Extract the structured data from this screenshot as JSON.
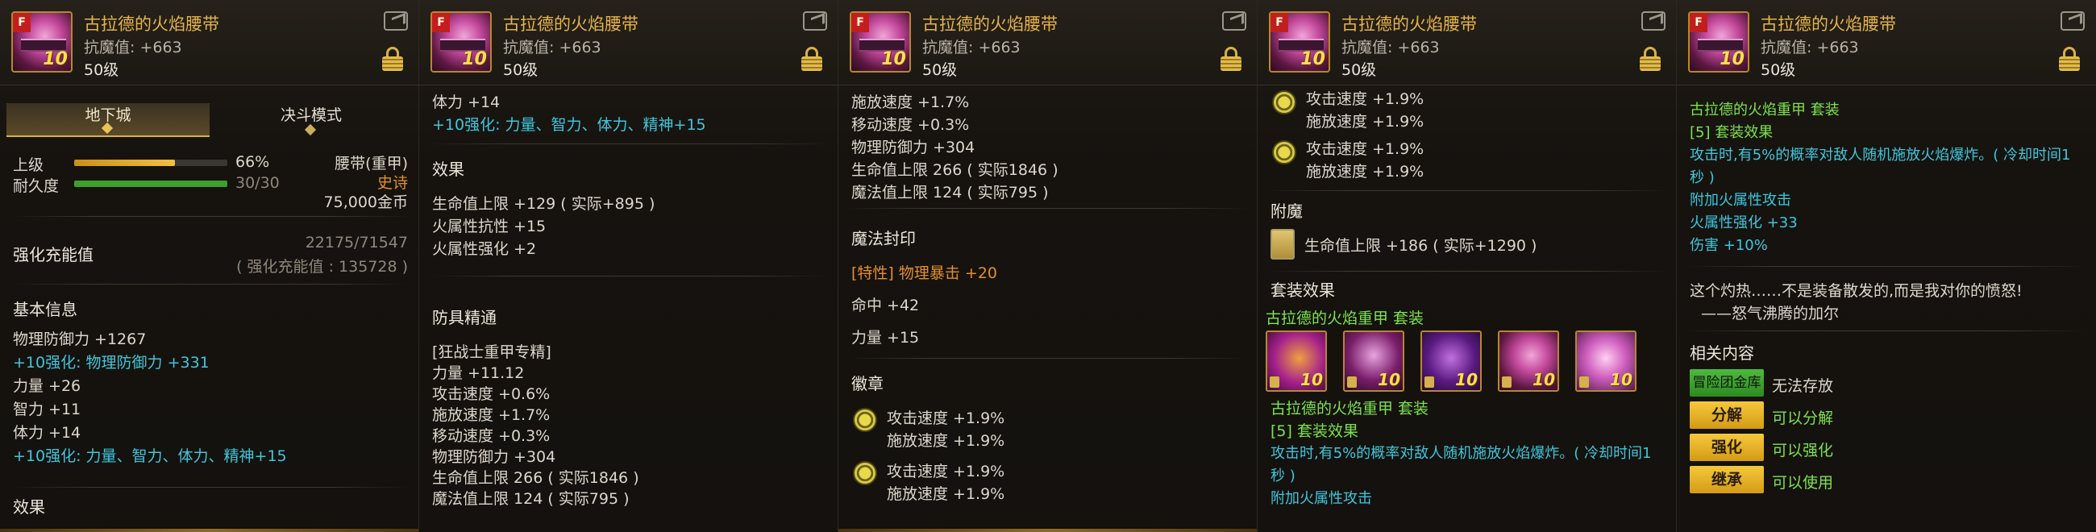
{
  "header": {
    "item_name": "古拉德的火焰腰带",
    "resist_stat": "抗魔值: +663",
    "level": "50级",
    "icon_tag": "F",
    "icon_upgrade": "10"
  },
  "panel1": {
    "tabs": [
      "地下城",
      "决斗模式"
    ],
    "grade_label": "上级",
    "grade_value": "66%",
    "grade_fill": 0.66,
    "durability_label": "耐久度",
    "durability_value": "30/30",
    "durability_fill": 1.0,
    "slot": "腰带(重甲)",
    "rarity": "史诗",
    "price": "75,000金币",
    "reinforce_label": "强化充能值",
    "reinforce_value": "22175/71547",
    "reinforce_detail": "( 强化充能值 : 135728 )",
    "basic_info": "基本信息",
    "stats": [
      {
        "text": "物理防御力 +1267",
        "color": "w"
      },
      {
        "text": "+10强化: 物理防御力 +331",
        "color": "cy"
      },
      {
        "text": "力量 +26",
        "color": "w"
      },
      {
        "text": "智力 +11",
        "color": "w"
      },
      {
        "text": "体力 +14",
        "color": "w"
      },
      {
        "text": "+10强化: 力量、智力、体力、精神+15",
        "color": "cy"
      }
    ],
    "effects_title": "效果"
  },
  "panel2": {
    "top_lines": [
      {
        "text": "体力 +14",
        "color": "w"
      },
      {
        "text": "+10强化: 力量、智力、体力、精神+15",
        "color": "cy"
      }
    ],
    "effects_title": "效果",
    "effects": [
      "生命值上限 +129 ( 实际+895 )",
      "火属性抗性 +15",
      "火属性强化 +2"
    ],
    "mastery_title": "防具精通",
    "mastery": [
      "[狂战士重甲专精]",
      "力量 +11.12",
      "攻击速度 +0.6%",
      "施放速度 +1.7%",
      "移动速度 +0.3%",
      "物理防御力 +304",
      "生命值上限 266 ( 实际1846 )",
      "魔法值上限 124 ( 实际795 )"
    ]
  },
  "panel3": {
    "top_lines": [
      "施放速度 +1.7%",
      "移动速度 +0.3%",
      "物理防御力 +304",
      "生命值上限 266 ( 实际1846 )",
      "魔法值上限 124 ( 实际795 )"
    ],
    "seal_title": "魔法封印",
    "seals": [
      {
        "text": "[特性] 物理暴击 +20",
        "color": "og"
      },
      {
        "text": "命中 +42",
        "color": "w"
      },
      {
        "text": "力量 +15",
        "color": "w"
      }
    ],
    "emblem_title": "徽章",
    "emblems": [
      {
        "line1": "攻击速度 +1.9%",
        "line2": "施放速度 +1.9%"
      },
      {
        "line1": "攻击速度 +1.9%",
        "line2": "施放速度 +1.9%"
      }
    ]
  },
  "panel4": {
    "emblems": [
      {
        "line1": "攻击速度 +1.9%",
        "line2": "施放速度 +1.9%"
      },
      {
        "line1": "攻击速度 +1.9%",
        "line2": "施放速度 +1.9%"
      }
    ],
    "enchant_title": "附魔",
    "enchant": "生命值上限 +186 ( 实际+1290 )",
    "set_effects_title": "套装效果",
    "set_name": "古拉德的火焰重甲 套装",
    "set_icon_upgrade": "10",
    "set_name2": "古拉德的火焰重甲 套装",
    "set_bonus_title": "[5] 套装效果",
    "set_desc1": "攻击时,有5%的概率对敌人随机施放火焰爆炸。( 冷却时间1",
    "set_desc2": "秒 )",
    "set_extra": "附加火属性攻击"
  },
  "panel5": {
    "set_name": "古拉德的火焰重甲 套装",
    "set_bonus_title": "[5] 套装效果",
    "set_desc1": "攻击时,有5%的概率对敌人随机施放火焰爆炸。( 冷却时间1",
    "set_desc2": "秒 )",
    "set_extra1": "附加火属性攻击",
    "set_extra2": "火属性强化 +33",
    "set_extra3": "伤害 +10%",
    "flavor1": "这个灼热……不是装备散发的,而是我对你的愤怒!",
    "flavor2": "——怒气沸腾的加尔",
    "related_title": "相关内容",
    "bank_button": "冒险团金库",
    "bank_status": "无法存放",
    "actions": [
      {
        "label": "分解",
        "status": "可以分解"
      },
      {
        "label": "强化",
        "status": "可以强化"
      },
      {
        "label": "继承",
        "status": "可以使用"
      }
    ]
  },
  "colors": {
    "gold": "#e6b44a",
    "cyan": "#40c6dc",
    "green": "#7de24e",
    "orange": "#e28f2e"
  }
}
